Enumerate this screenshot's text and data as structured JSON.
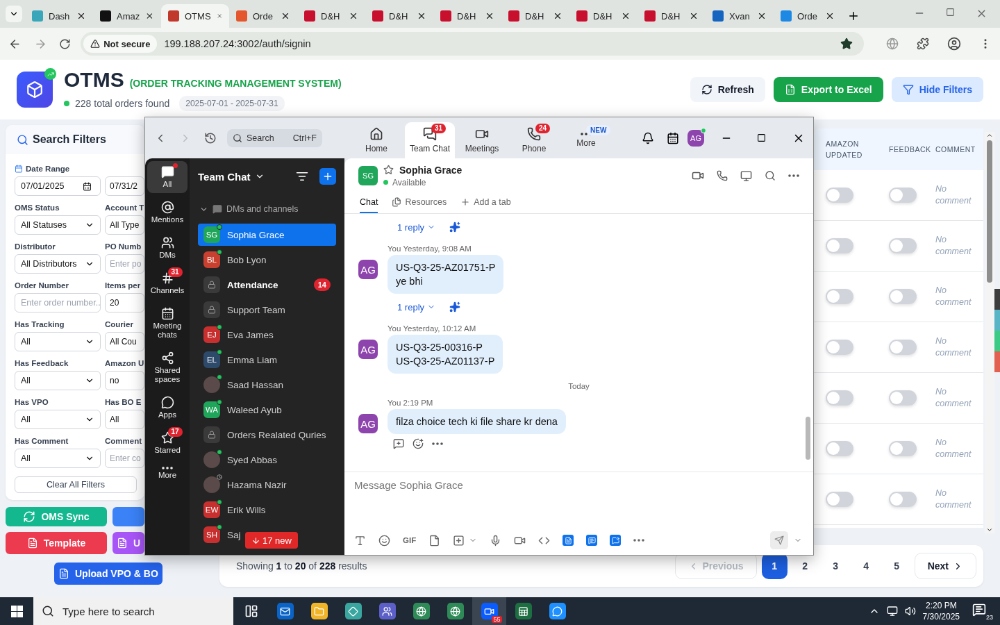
{
  "browser": {
    "tabs": [
      {
        "title": "Dash",
        "kind": "dash",
        "selected": false
      },
      {
        "title": "Amaz",
        "kind": "amazon",
        "selected": false
      },
      {
        "title": "OTMS",
        "kind": "otms",
        "selected": true
      },
      {
        "title": "Orde",
        "kind": "orders",
        "selected": false
      },
      {
        "title": "D&H",
        "kind": "dh",
        "selected": false
      },
      {
        "title": "D&H",
        "kind": "dh",
        "selected": false
      },
      {
        "title": "D&H",
        "kind": "dh",
        "selected": false
      },
      {
        "title": "D&H",
        "kind": "dh",
        "selected": false
      },
      {
        "title": "D&H",
        "kind": "dh",
        "selected": false
      },
      {
        "title": "D&H",
        "kind": "dh",
        "selected": false
      },
      {
        "title": "Xvan",
        "kind": "xvan",
        "selected": false
      },
      {
        "title": "Orde",
        "kind": "ec",
        "selected": false
      }
    ],
    "security": "Not secure",
    "url": "199.188.207.24:3002/auth/signin"
  },
  "header": {
    "title": "OTMS",
    "subtitle": "(ORDER TRACKING MANAGEMENT SYSTEM)",
    "summary": "228 total orders found",
    "date_range": "2025-07-01 - 2025-07-31",
    "buttons": [
      {
        "label": "Refresh",
        "kind": "refresh"
      },
      {
        "label": "Export to Excel",
        "kind": "export"
      },
      {
        "label": "Hide Filters",
        "kind": "filter"
      }
    ]
  },
  "filters": {
    "title": "Search Filters",
    "date_label": "Date Range",
    "date_from": "07/01/2025",
    "date_to": "07/31/2",
    "fields": [
      {
        "label": "OMS Status",
        "kind": "select",
        "value": "All Statuses"
      },
      {
        "label": "Account T",
        "kind": "input",
        "value": "All Type"
      },
      {
        "label": "Distributor",
        "kind": "select",
        "value": "All Distributors"
      },
      {
        "label": "PO Numb",
        "kind": "input",
        "placeholder": "Enter po"
      },
      {
        "label": "Order Number",
        "kind": "input",
        "placeholder": "Enter order number.."
      },
      {
        "label": "Items per",
        "kind": "input",
        "value": "20"
      },
      {
        "label": "Has Tracking",
        "kind": "select",
        "value": "All"
      },
      {
        "label": "Courier",
        "kind": "input",
        "value": "All Cou"
      },
      {
        "label": "Has Feedback",
        "kind": "select",
        "value": "All"
      },
      {
        "label": "Amazon U",
        "kind": "input",
        "value": "no"
      },
      {
        "label": "Has VPO",
        "kind": "select",
        "value": "All"
      },
      {
        "label": "Has BO E",
        "kind": "input",
        "value": "All"
      },
      {
        "label": "Has Comment",
        "kind": "select",
        "value": "All"
      },
      {
        "label": "Comment",
        "kind": "input",
        "placeholder": "Enter co"
      }
    ],
    "clear": "Clear All Filters"
  },
  "actions": [
    {
      "label": "OMS Sync",
      "kind": "sync",
      "color": "#14b88f"
    },
    {
      "kind": "blank",
      "color": "#3b82f6"
    },
    {
      "label": "Template",
      "kind": "file",
      "color": "#ec3a4e"
    },
    {
      "label": "U",
      "kind": "file",
      "color": "#a855f7"
    },
    {
      "label": "Upload VPO & BO",
      "kind": "file",
      "color": "#2563eb"
    }
  ],
  "table": {
    "columns": [
      "AMAZON UPDATED",
      "FEEDBACK",
      "COMMENT"
    ],
    "rows": [
      {
        "amazon_updated": false,
        "feedback": false,
        "comment": "No comment"
      },
      {
        "amazon_updated": false,
        "feedback": false,
        "comment": "No comment"
      },
      {
        "amazon_updated": false,
        "feedback": false,
        "comment": "No comment"
      },
      {
        "amazon_updated": false,
        "feedback": false,
        "comment": "No comment"
      },
      {
        "amazon_updated": false,
        "feedback": false,
        "comment": "No comment"
      },
      {
        "amazon_updated": false,
        "feedback": false,
        "comment": "No comment"
      },
      {
        "amazon_updated": false,
        "feedback": false,
        "comment": "No comment"
      }
    ]
  },
  "pagination": {
    "summary": "Showing **1** to **20** of **228** results",
    "previous": "Previous",
    "previous_disabled": true,
    "pages": [
      {
        "label": "1",
        "selected": true
      },
      {
        "label": "2",
        "selected": false
      },
      {
        "label": "3",
        "selected": false
      },
      {
        "label": "4",
        "selected": false
      },
      {
        "label": "5",
        "selected": false
      }
    ],
    "next": "Next"
  },
  "chat": {
    "search": "Search",
    "shortcut": "Ctrl+F",
    "tabs": [
      {
        "label": "Home",
        "kind": "home",
        "selected": false
      },
      {
        "label": "Team Chat",
        "kind": "chat",
        "selected": true,
        "badge": "31"
      },
      {
        "label": "Meetings",
        "kind": "video",
        "selected": false
      },
      {
        "label": "Phone",
        "kind": "phone",
        "selected": false,
        "badge": "24"
      },
      {
        "label": "More",
        "kind": "more",
        "selected": false,
        "tag": "NEW"
      }
    ],
    "avatar": "AG",
    "rail": [
      {
        "label": "All",
        "kind": "all",
        "selected": true
      },
      {
        "label": "Mentions",
        "kind": "mentions",
        "selected": false
      },
      {
        "label": "DMs",
        "kind": "dms",
        "selected": false
      },
      {
        "label": "Channels",
        "kind": "channels",
        "selected": false,
        "badge": "31"
      },
      {
        "label": "Meeting chats",
        "kind": "meetings",
        "selected": false
      },
      {
        "label": "Shared spaces",
        "kind": "shared",
        "selected": false
      },
      {
        "label": "Apps",
        "kind": "apps",
        "selected": false
      },
      {
        "label": "Starred",
        "kind": "starred",
        "selected": false,
        "badge": "17"
      },
      {
        "label": "More",
        "kind": "more",
        "selected": false
      }
    ],
    "list_title": "Team Chat",
    "section": "DMs and channels",
    "items": [
      {
        "name": "Sophia Grace",
        "kind": "person",
        "initials": "SG",
        "color": "#1fa65a",
        "online": true,
        "selected": true
      },
      {
        "name": "Bob Lyon",
        "kind": "person",
        "initials": "BL",
        "color": "#c8402f",
        "online": true,
        "selected": false
      },
      {
        "name": "Attendance",
        "kind": "channel",
        "unread": true,
        "badge": "14",
        "selected": false
      },
      {
        "name": "Support Team",
        "kind": "channel",
        "selected": false
      },
      {
        "name": "Eva James",
        "kind": "person",
        "initials": "EJ",
        "color": "#c8302f",
        "online": true,
        "selected": false
      },
      {
        "name": "Emma Liam",
        "kind": "person",
        "initials": "EL",
        "color": "#2d4a6a",
        "online": true,
        "selected": false
      },
      {
        "name": "Saad Hassan",
        "kind": "photo",
        "online": true,
        "selected": false
      },
      {
        "name": "Waleed Ayub",
        "kind": "person",
        "initials": "WA",
        "color": "#1fa65a",
        "online": true,
        "selected": false
      },
      {
        "name": "Orders Realated Quries",
        "kind": "channel",
        "selected": false
      },
      {
        "name": "Syed Abbas",
        "kind": "photo",
        "online": true,
        "selected": false
      },
      {
        "name": "Hazama Nazir",
        "kind": "photo",
        "away": true,
        "selected": false
      },
      {
        "name": "Erik Wills",
        "kind": "person",
        "initials": "EW",
        "color": "#c8302f",
        "online": true,
        "selected": false
      },
      {
        "name": "Saj",
        "kind": "person",
        "initials": "SH",
        "color": "#c8302f",
        "online": true,
        "selected": false
      }
    ],
    "new_pill": "17 new",
    "conversation": {
      "name": "Sophia Grace",
      "initials": "SG",
      "status": "Available",
      "tabs": [
        {
          "label": "Chat",
          "kind": "chat",
          "selected": true
        },
        {
          "label": "Resources",
          "kind": "resources",
          "selected": false
        },
        {
          "label": "Add a tab",
          "kind": "add",
          "selected": false
        }
      ],
      "feed": [
        {
          "kind": "reply",
          "label": "1 reply"
        },
        {
          "kind": "message",
          "author": "You",
          "time": "Yesterday, 9:08 AM",
          "initials": "AG",
          "text": "US-Q3-25-AZ01751-P\nye bhi"
        },
        {
          "kind": "reply",
          "label": "1 reply"
        },
        {
          "kind": "message",
          "author": "You",
          "time": "Yesterday, 10:12 AM",
          "initials": "AG",
          "text": "US-Q3-25-00316-P\nUS-Q3-25-AZ01137-P"
        },
        {
          "kind": "divider",
          "label": "Today"
        },
        {
          "kind": "message",
          "author": "You",
          "time": "2:19 PM",
          "initials": "AG",
          "text": "filza choice tech ki file share kr dena",
          "actions": true
        }
      ],
      "placeholder": "Message Sophia Grace",
      "gif": "GIF"
    }
  },
  "taskbar": {
    "search": "Type here to search",
    "apps": [
      {
        "kind": "taskview",
        "selected": false
      },
      {
        "kind": "outlook",
        "selected": false
      },
      {
        "kind": "files",
        "selected": false
      },
      {
        "kind": "diamond",
        "selected": false
      },
      {
        "kind": "teams",
        "selected": false
      },
      {
        "kind": "chrome",
        "selected": false
      },
      {
        "kind": "chrome",
        "selected": false
      },
      {
        "kind": "zoom",
        "selected": true,
        "badge": "55"
      },
      {
        "kind": "excel",
        "selected": false
      },
      {
        "kind": "bubble",
        "selected": false
      }
    ],
    "time": "2:20 PM",
    "date": "7/30/2025",
    "notifications": "23"
  }
}
